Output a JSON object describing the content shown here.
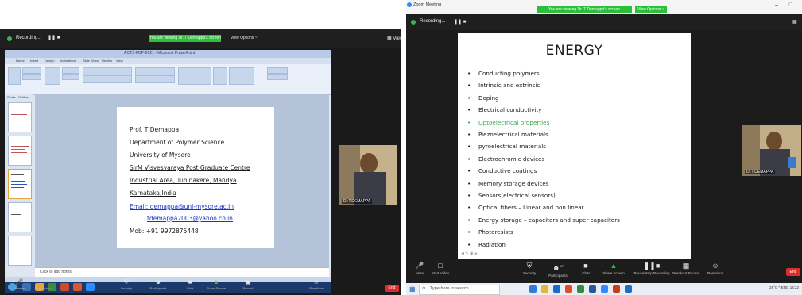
{
  "left_meeting": {
    "recording_label": "Recording...",
    "banner": "You are viewing Dr. T Demappa's screen",
    "view_options": "View Options ~",
    "ppt": {
      "title": "ACTS-FDP-2021 - Microsoft PowerPoint",
      "tabs": [
        "Home",
        "Insert",
        "Design",
        "Animations",
        "Slide Show",
        "Review",
        "View"
      ],
      "slides_tab": "Slides",
      "outline_tab": "Outline",
      "notes_placeholder": "Click to add notes",
      "slide_lines": [
        {
          "text": "Prof. T Demappa",
          "style": ""
        },
        {
          "text": "Department of Polymer Science",
          "style": ""
        },
        {
          "text": "University of Mysore",
          "style": ""
        },
        {
          "text": "SirM Visvesvaraya Post Graduate Centre",
          "style": "u"
        },
        {
          "text": "Industrial Area, Tubinakere, Mandya",
          "style": "u"
        },
        {
          "text": "Karnataka,India",
          "style": "u"
        },
        {
          "text": "Email: demappa@uni-mysore.ac.in",
          "style": "link"
        },
        {
          "text": "tdemappa2003@yahoo.co.in",
          "style": "link"
        },
        {
          "text": "Mob: +91 9972875448",
          "style": ""
        }
      ]
    },
    "participant_name": "Dr.T.DEMAPPA",
    "controls": [
      "Unmute",
      "Start Video",
      "Security",
      "Participants",
      "Chat",
      "Share Screen",
      "Record",
      "Reactions"
    ],
    "end_label": "End"
  },
  "right_meeting": {
    "window_title": "Zoom Meeting",
    "recording_label": "Recording...",
    "banner": "You are viewing Dr. T Demappa's screen",
    "view_options": "View Options ~",
    "slide": {
      "title": "ENERGY",
      "bullets": [
        "Conducting polymers",
        "Intrinsic  and extrinsic",
        "Doping",
        "Electrical conductivity",
        "Optoelectrical properties",
        "Piezoelectrical materials",
        "pyroelectrical materials",
        "Electrochromic devices",
        "Conductive coatings",
        "Memory storage  devices",
        "Sensors(electrical sensors)",
        "Optical fibers – Linear  and  non linear",
        "Energy storage – capacitors and super capacitors",
        "Photoresists",
        "Radiation"
      ],
      "highlight_color": "#3aa64c"
    },
    "participant_name": "Dr.T.DEMAPPA",
    "controls": [
      "Mute",
      "Start Video",
      "Security",
      "Participants",
      "Chat",
      "Share Screen",
      "Pause/Stop Recording",
      "Breakout Rooms",
      "Reactions"
    ],
    "participants_count": "47",
    "end_label": "End",
    "taskbar": {
      "search_placeholder": "Type here to search",
      "tray": "29°C  ^  ENG  14:22"
    }
  }
}
